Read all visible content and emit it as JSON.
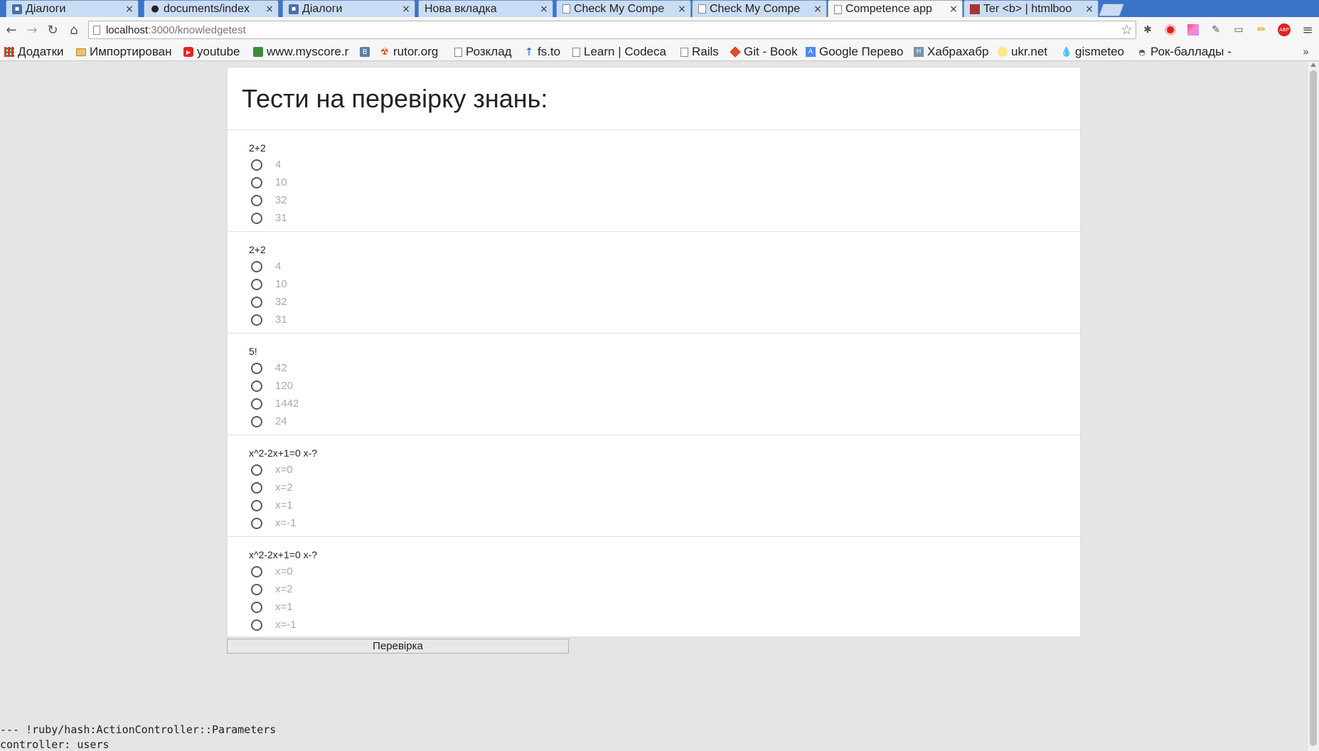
{
  "tabs": [
    {
      "title": "Діалоги",
      "icon": "dialog-icon",
      "active": false
    },
    {
      "title": "documents/index",
      "icon": "github-icon",
      "active": false
    },
    {
      "title": "Діалоги",
      "icon": "dialog-icon",
      "active": false
    },
    {
      "title": "Нова вкладка",
      "icon": "",
      "active": false
    },
    {
      "title": "Check My Compe",
      "icon": "page-icon",
      "active": false
    },
    {
      "title": "Check My Compe",
      "icon": "page-icon",
      "active": false
    },
    {
      "title": "Competence app",
      "icon": "page-icon",
      "active": true
    },
    {
      "title": "Ter <b> | htmlboo",
      "icon": "tag-icon",
      "active": false
    }
  ],
  "address": {
    "host": "localhost",
    "path": ":3000/knowledgetest"
  },
  "bookmarks": [
    {
      "label": "Додатки",
      "icon": "apps-grid-icon"
    },
    {
      "label": "Импортирован",
      "icon": "folder-icon"
    },
    {
      "label": "youtube",
      "icon": "youtube-icon"
    },
    {
      "label": "www.myscore.r",
      "icon": "myscore-icon"
    },
    {
      "label": "",
      "icon": "vk-icon"
    },
    {
      "label": "rutor.org",
      "icon": "rutor-icon"
    },
    {
      "label": "Розклад",
      "icon": "page-icon"
    },
    {
      "label": "fs.to",
      "icon": "arrow-up-icon"
    },
    {
      "label": "Learn | Codeca",
      "icon": "codecademy-icon"
    },
    {
      "label": "Rails",
      "icon": "page-icon"
    },
    {
      "label": "Git - Book",
      "icon": "git-icon"
    },
    {
      "label": "Google Перево",
      "icon": "google-translate-icon"
    },
    {
      "label": "Хабрахабр",
      "icon": "habr-icon"
    },
    {
      "label": "ukr.net",
      "icon": "ukrnet-icon"
    },
    {
      "label": "gismeteo",
      "icon": "drop-icon"
    },
    {
      "label": "Рок-баллады -",
      "icon": "mask-icon"
    }
  ],
  "page": {
    "heading": "Тести на перевірку знань:",
    "questions": [
      {
        "text": "2+2",
        "options": [
          "4",
          "10",
          "32",
          "31"
        ]
      },
      {
        "text": "2+2",
        "options": [
          "4",
          "10",
          "32",
          "31"
        ]
      },
      {
        "text": "5!",
        "options": [
          "42",
          "120",
          "1442",
          "24"
        ]
      },
      {
        "text": "x^2-2x+1=0 x-?",
        "options": [
          "x=0",
          "x=2",
          "x=1",
          "x=-1"
        ]
      },
      {
        "text": "x^2-2x+1=0 x-?",
        "options": [
          "x=0",
          "x=2",
          "x=1",
          "x=-1"
        ]
      }
    ],
    "submit_label": "Перевірка",
    "debug_lines": [
      "--- !ruby/hash:ActionController::Parameters",
      "controller: users"
    ]
  }
}
